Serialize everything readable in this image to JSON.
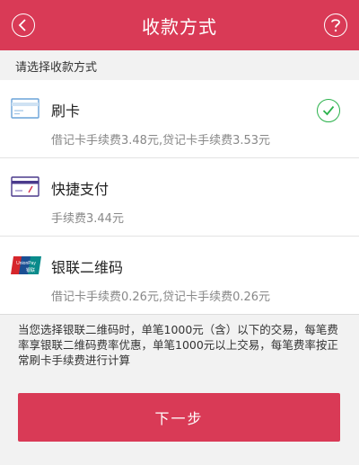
{
  "colors": {
    "brand": "#d93a56",
    "check": "#2bb24c"
  },
  "header": {
    "title": "收款方式",
    "back_icon": "back-arrow-icon",
    "help_icon": "help-icon"
  },
  "section_label": "请选择收款方式",
  "options": [
    {
      "icon": "card-icon",
      "name": "刷卡",
      "fee": "借记卡手续费3.48元,贷记卡手续费3.53元",
      "selected": true
    },
    {
      "icon": "quick-pay-card-icon",
      "name": "快捷支付",
      "fee": "手续费3.44元",
      "selected": false
    },
    {
      "icon": "unionpay-logo-icon",
      "logo_text": "UnionPay 银联",
      "name": "银联二维码",
      "fee": "借记卡手续费0.26元,贷记卡手续费0.26元",
      "selected": false
    }
  ],
  "notice": "当您选择银联二维码时，单笔1000元（含）以下的交易，每笔费率享银联二维码费率优惠，单笔1000元以上交易，每笔费率按正常刷卡手续费进行计算",
  "next_button": "下一步"
}
